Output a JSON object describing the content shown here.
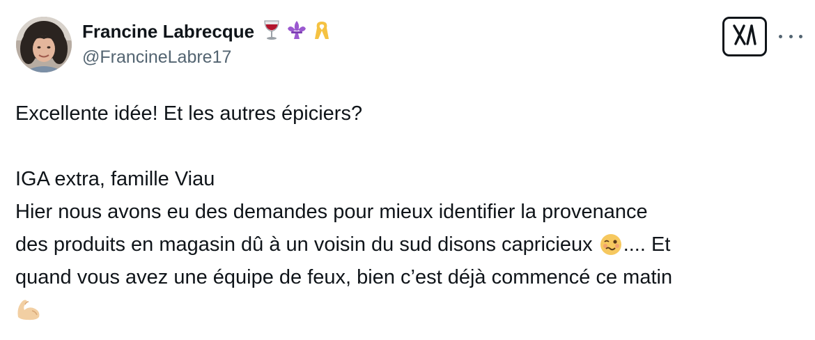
{
  "author": {
    "display_name": "Francine Labrecque",
    "handle": "@FrancineLabre17",
    "name_emojis": [
      "wine-glass-emoji",
      "fleur-de-lis-emoji",
      "yellow-ribbon-emoji"
    ]
  },
  "actions": {
    "x_logo": "x-grok-icon",
    "more": "more-icon"
  },
  "tweet": {
    "line1": "Excellente idée! Et les autres épiciers?",
    "line2": "IGA extra, famille Viau",
    "line3": "Hier nous avons eu des demandes pour mieux identifier la provenance",
    "line4_before": "des produits en magasin dû à un voisin du sud disons capricieux",
    "line4_after": ".... Et",
    "line5": "quand vous avez une équipe de feux, bien c’est déjà commencé ce matin",
    "emoji_1": "woozy-face-emoji",
    "emoji_2": "flexed-biceps-emoji"
  },
  "colors": {
    "text": "#0f1419",
    "secondary": "#536471"
  }
}
